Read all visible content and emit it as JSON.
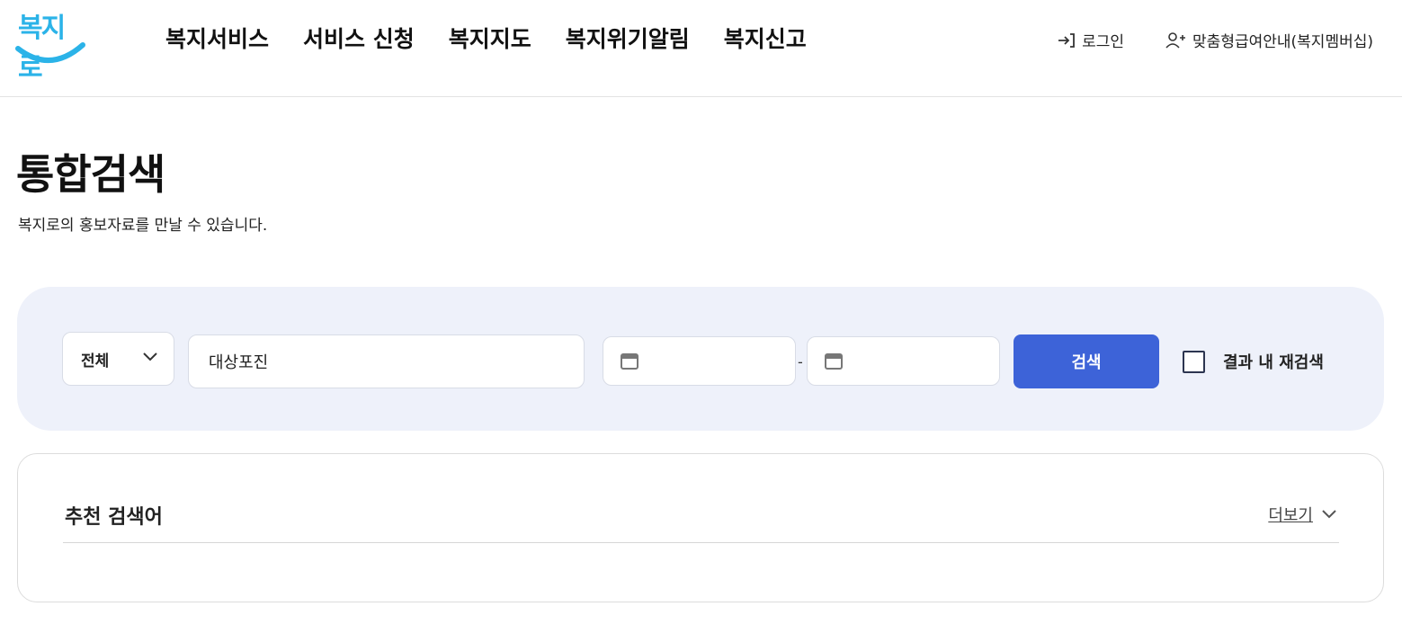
{
  "header": {
    "logo_text": "복지로",
    "nav": [
      {
        "label": "복지서비스"
      },
      {
        "label": "서비스 신청"
      },
      {
        "label": "복지지도"
      },
      {
        "label": "복지위기알림"
      },
      {
        "label": "복지신고"
      }
    ],
    "util": {
      "login_label": "로그인",
      "membership_label": "맞춤형급여안내(복지멤버십)"
    }
  },
  "page": {
    "title": "통합검색",
    "description": "복지로의 홍보자료를 만날 수 있습니다."
  },
  "search": {
    "category_selected": "전체",
    "keyword_value": "대상포진",
    "date_from_value": "",
    "date_to_value": "",
    "date_separator": "-",
    "search_button_label": "검색",
    "research_label": "결과 내 재검색",
    "research_checked": false
  },
  "recommend": {
    "title": "추천 검색어",
    "more_label": "더보기"
  },
  "colors": {
    "accent": "#3d63d8",
    "panel_bg": "#eef1fa",
    "logo": "#2bb3e8"
  },
  "icons": {
    "login": "login-icon",
    "membership": "user-plus-icon",
    "calendar": "calendar-icon",
    "chevron": "chevron-down-icon"
  }
}
